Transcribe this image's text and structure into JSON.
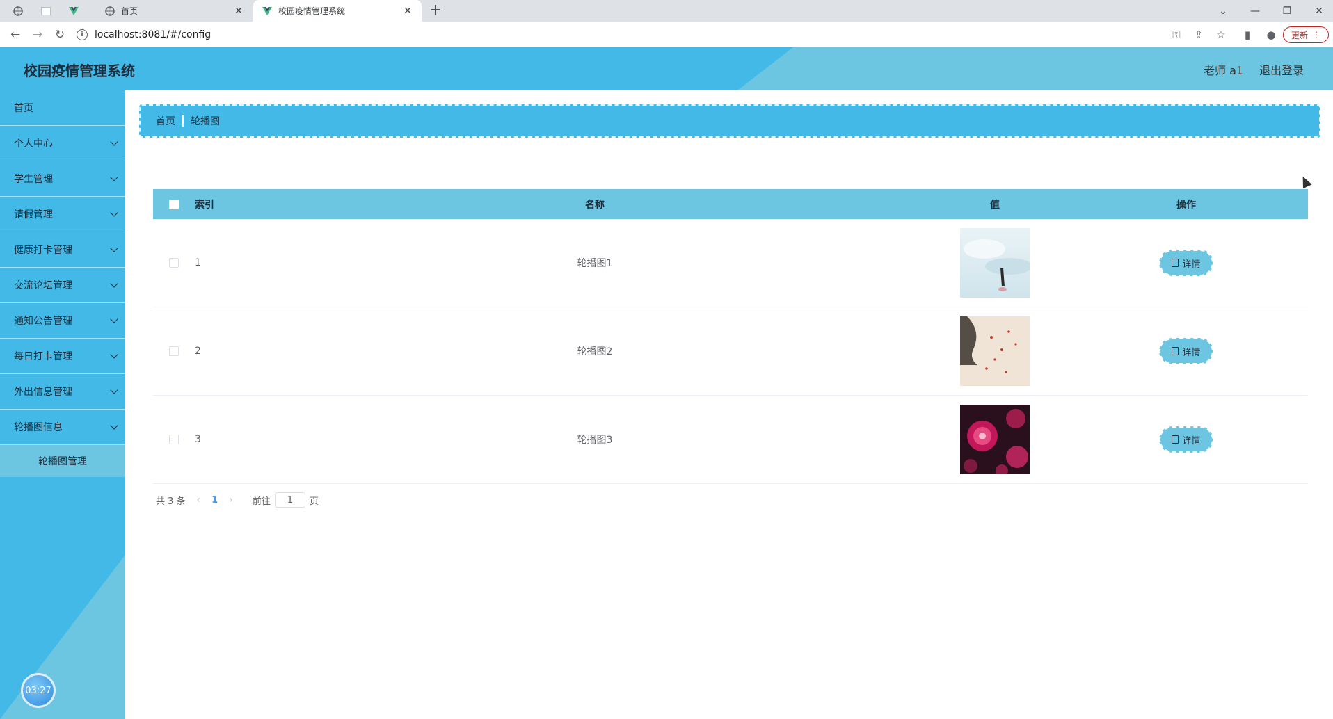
{
  "browser": {
    "tabs": [
      {
        "title": "首页"
      },
      {
        "title": "校园疫情管理系统"
      }
    ],
    "url": "localhost:8081/#/config",
    "update_label": "更新"
  },
  "header": {
    "title": "校园疫情管理系统",
    "user": "老师 a1",
    "logout": "退出登录"
  },
  "sidebar": {
    "items": [
      {
        "label": "首页"
      },
      {
        "label": "个人中心"
      },
      {
        "label": "学生管理"
      },
      {
        "label": "请假管理"
      },
      {
        "label": "健康打卡管理"
      },
      {
        "label": "交流论坛管理"
      },
      {
        "label": "通知公告管理"
      },
      {
        "label": "每日打卡管理"
      },
      {
        "label": "外出信息管理"
      },
      {
        "label": "轮播图信息"
      }
    ],
    "subitem": "轮播图管理",
    "clock": "03:27"
  },
  "breadcrumb": {
    "home": "首页",
    "current": "轮播图"
  },
  "table": {
    "headers": {
      "index": "索引",
      "name": "名称",
      "value": "值",
      "action": "操作"
    },
    "rows": [
      {
        "index": "1",
        "name": "轮播图1",
        "detail": "详情"
      },
      {
        "index": "2",
        "name": "轮播图2",
        "detail": "详情"
      },
      {
        "index": "3",
        "name": "轮播图3",
        "detail": "详情"
      }
    ]
  },
  "pager": {
    "total": "共 3 条",
    "current": "1",
    "goto_prefix": "前往",
    "goto_value": "1",
    "goto_suffix": "页"
  }
}
